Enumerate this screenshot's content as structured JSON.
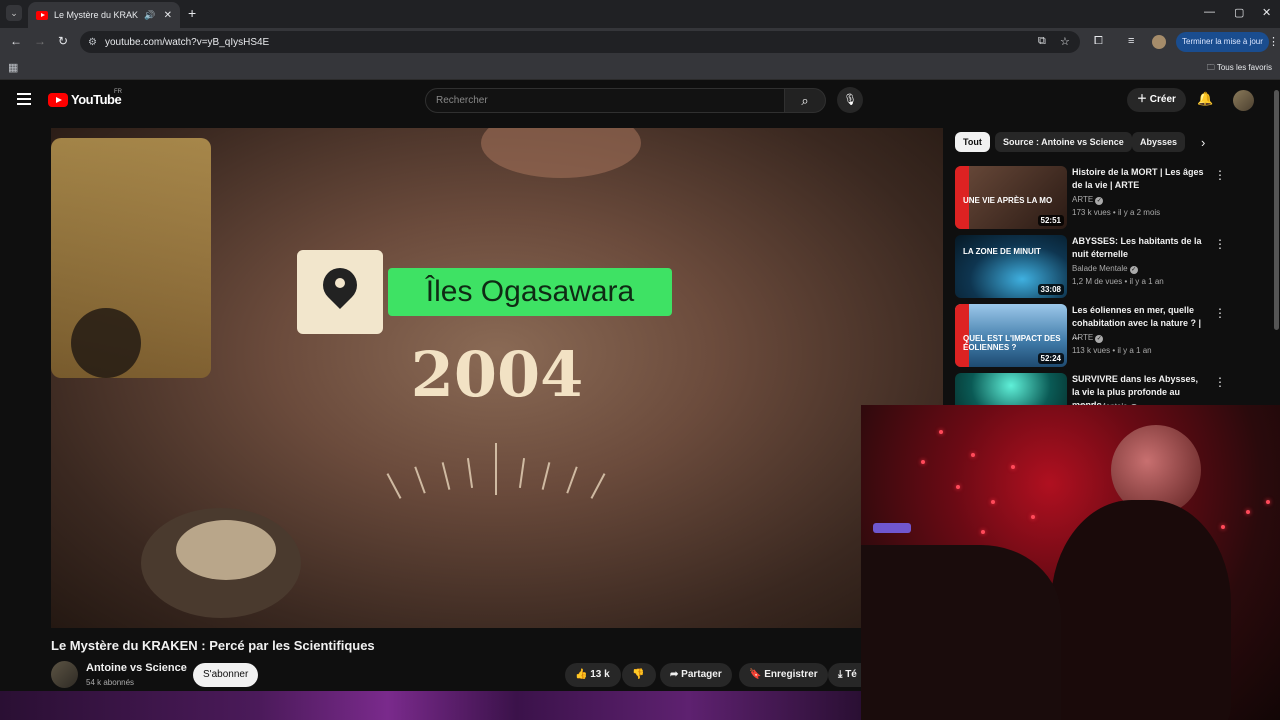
{
  "browser": {
    "tab_title": "Le Mystère du KRAKEN : Pe",
    "url": "youtube.com/watch?v=yB_qIysHS4E",
    "update_button": "Terminer la mise à jour",
    "bookmarks_all": "Tous les favoris"
  },
  "youtube": {
    "logo": "YouTube",
    "country": "FR",
    "search_placeholder": "Rechercher",
    "create_label": "Créer"
  },
  "video": {
    "overlay_place": "Îles Ogasawara",
    "overlay_year": "2004",
    "title": "Le Mystère du KRAKEN : Percé par les Scientifiques",
    "channel": "Antoine vs Science",
    "subscribers": "54 k abonnés",
    "subscribe_label": "S'abonner",
    "likes": "13 k",
    "share_label": "Partager",
    "save_label": "Enregistrer",
    "download_label": "Té"
  },
  "sidebar": {
    "chips": [
      "Tout",
      "Source : Antoine vs Science",
      "Abysses"
    ],
    "recommendations": [
      {
        "title": "Histoire de la MORT | Les âges de la vie | ARTE",
        "channel": "ARTE",
        "meta": "173 k vues • il y a 2 mois",
        "duration": "52:51",
        "thumb_text": "UNE VIE APRÈS LA MO",
        "thumb_color": "#5a3a30"
      },
      {
        "title": "ABYSSES: Les habitants de la nuit éternelle",
        "channel": "Balade Mentale",
        "meta": "1,2 M de vues • il y a 1 an",
        "duration": "33:08",
        "thumb_text": "LA ZONE DE MINUIT",
        "thumb_color": "#0e3550"
      },
      {
        "title": "Les éoliennes en mer, quelle cohabitation avec la nature ? | ...",
        "channel": "ARTE",
        "meta": "113 k vues • il y a 1 an",
        "duration": "52:24",
        "thumb_text": "QUEL EST L'IMPACT DES ÉOLIENNES ?",
        "thumb_color": "#3f7aa8"
      },
      {
        "title": "SURVIVRE dans les Abysses, la vie la plus profonde au monde",
        "channel": "Balade Mentale",
        "meta": "",
        "duration": "",
        "thumb_text": "",
        "thumb_color": "#0a5a55"
      }
    ]
  }
}
